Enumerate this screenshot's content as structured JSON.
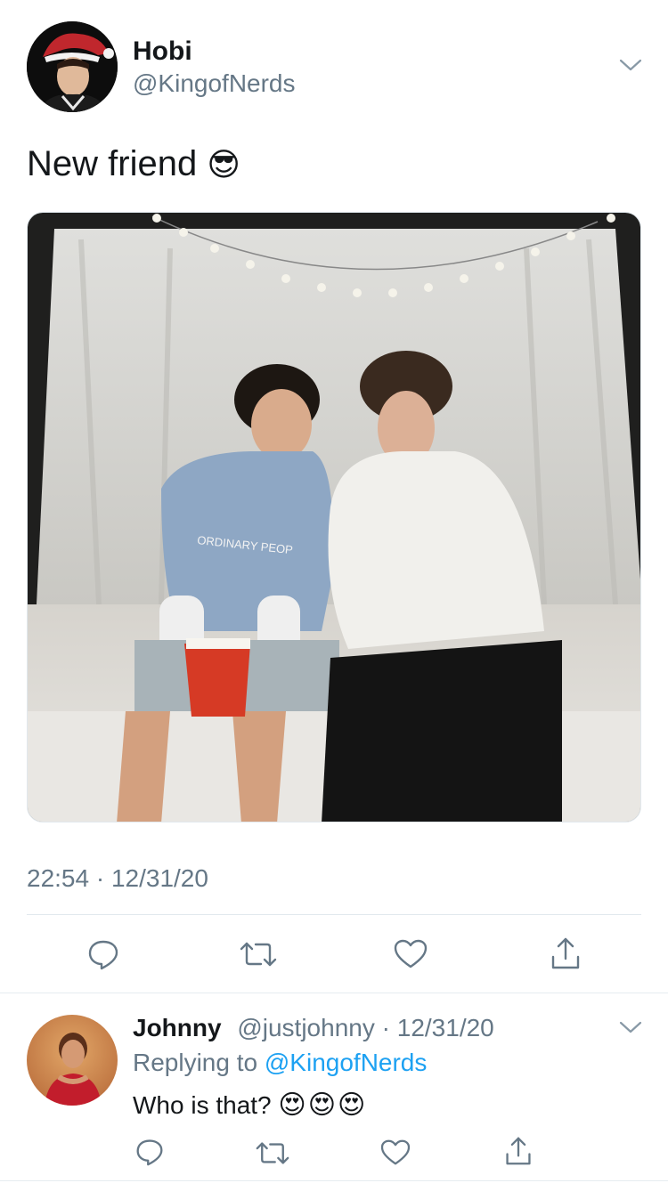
{
  "tweet": {
    "author_name": "Hobi",
    "author_handle": "@KingofNerds",
    "text": "New friend",
    "text_emoji": "😎",
    "time": "22:54 · 12/31/20",
    "photo_shirt_text": "ORDINARY PEOP"
  },
  "reply": {
    "author_name": "Johnny",
    "author_handle": "@justjohnny",
    "date": "· 12/31/20",
    "replying_prefix": "Replying to",
    "replying_to": "@KingofNerds",
    "text": "Who is that?",
    "emojis": "😍😍😍"
  },
  "colors": {
    "text": "#14171a",
    "muted": "#657786",
    "accent": "#1da1f2",
    "divider": "#e1e8ed"
  }
}
